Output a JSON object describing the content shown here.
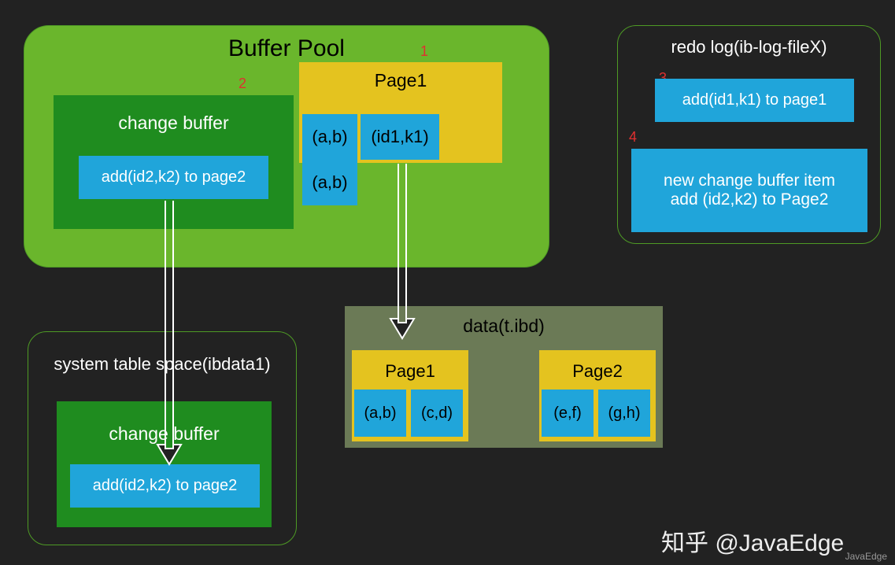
{
  "buffer_pool": {
    "title": "Buffer Pool",
    "change_buffer": {
      "title": "change buffer",
      "entry": "add(id2,k2) to page2"
    },
    "page1": {
      "title": "Page1",
      "cells": [
        "(a,b)",
        "(id1,k1)",
        "(a,b)"
      ]
    }
  },
  "numbers": {
    "n1": "1",
    "n2": "2",
    "n3": "3",
    "n4": "4"
  },
  "redo_log": {
    "title": "redo log(ib-log-fileX)",
    "item1": "add(id1,k1) to page1",
    "item2_line1": "new change buffer item",
    "item2_line2": "add (id2,k2) to Page2"
  },
  "system_tablespace": {
    "title": "system table space(ibdata1)",
    "change_buffer": {
      "title": "change buffer",
      "entry": "add(id2,k2) to page2"
    }
  },
  "data_file": {
    "title": "data(t.ibd)",
    "page1": {
      "title": "Page1",
      "cells": [
        "(a,b)",
        "(c,d)"
      ]
    },
    "page2": {
      "title": "Page2",
      "cells": [
        "(e,f)",
        "(g,h)"
      ]
    }
  },
  "watermark": {
    "main": "知乎 @JavaEdge",
    "small": "JavaEdge"
  }
}
